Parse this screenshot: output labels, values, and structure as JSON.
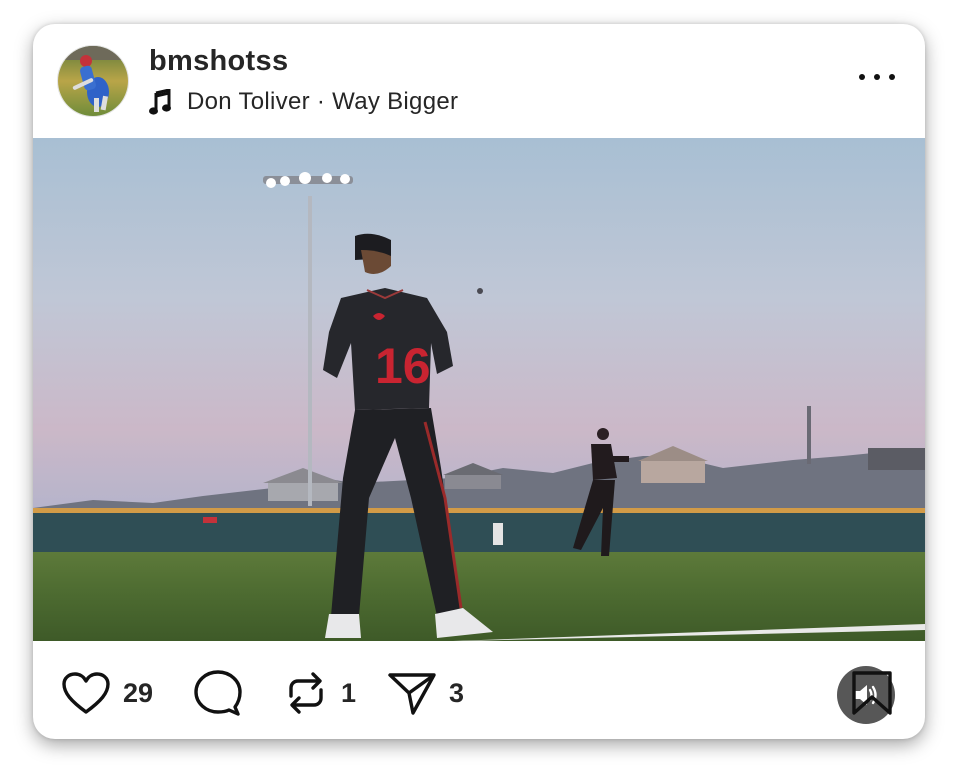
{
  "post": {
    "username": "bmshotss",
    "audio": "Don Toliver · Way Bigger",
    "more_icon": "more-horizontal-icon",
    "media": {
      "description_icon": "photo",
      "jersey_number": "16",
      "sound_icon": "speaker-icon"
    },
    "actions": {
      "like_count": "29",
      "repost_count": "1",
      "share_count": "3"
    },
    "colors": {
      "text": "#262626",
      "accent_red": "#c92431"
    }
  }
}
